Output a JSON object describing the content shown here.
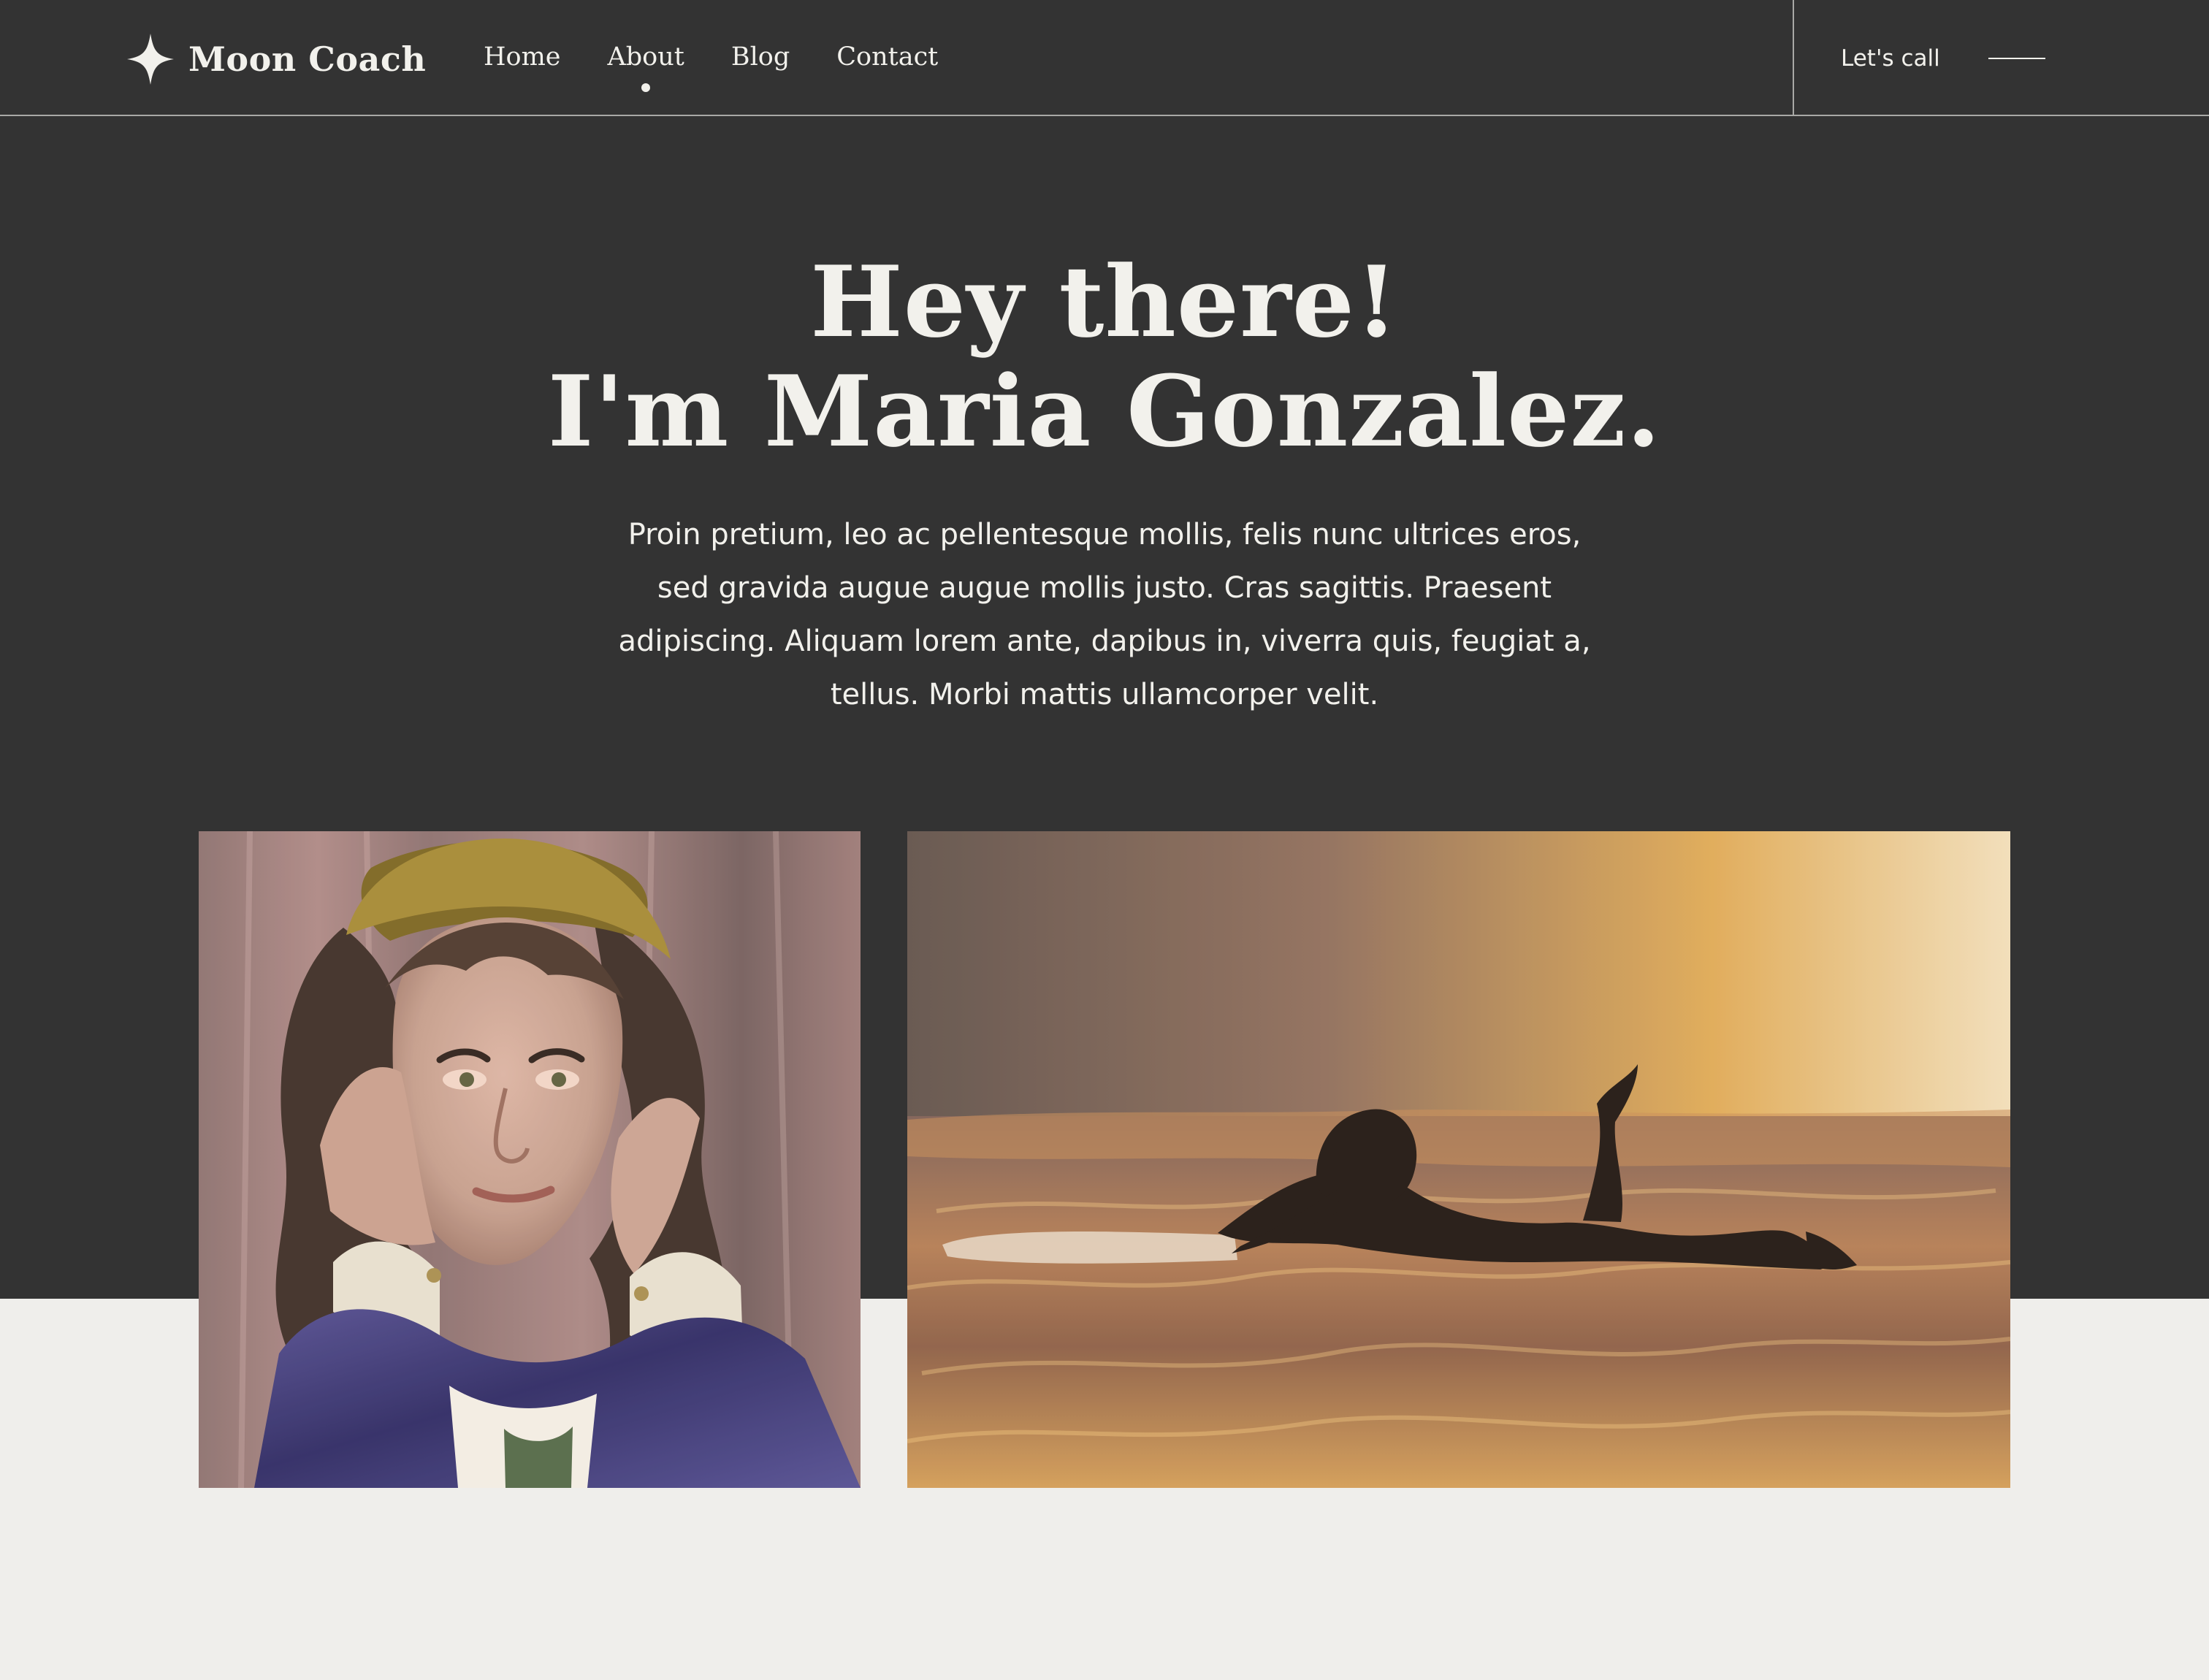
{
  "brand": {
    "name": "Moon Coach",
    "icon": "sparkle-icon"
  },
  "nav": {
    "items": [
      {
        "label": "Home",
        "active": false
      },
      {
        "label": "About",
        "active": true
      },
      {
        "label": "Blog",
        "active": false
      },
      {
        "label": "Contact",
        "active": false
      }
    ]
  },
  "header": {
    "cta_label": "Let's call",
    "cta_icon": "line-arrow-icon"
  },
  "hero": {
    "title_line_1": "Hey there!",
    "title_line_2": "I'm Maria Gonzalez.",
    "body": "Proin pretium, leo ac pellentesque mollis, felis nunc ultrices eros, sed gravida augue augue mollis justo. Cras sagittis. Praesent adipiscing. Aliquam lorem ante, dapibus in, viverra quis, feugiat a, tellus. Morbi mattis ullamcorper velit."
  },
  "colors": {
    "dark_background": "#333333",
    "light_background": "#efeeeb",
    "text_light": "#f2f1ec",
    "divider": "#a9a9a6"
  }
}
